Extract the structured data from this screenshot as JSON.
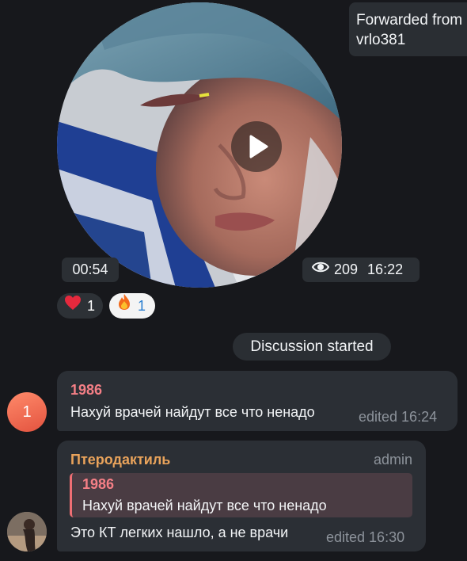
{
  "forwarded": {
    "line1": "Forwarded from",
    "line2": "vrlo381"
  },
  "video": {
    "duration": "00:54",
    "views": "209",
    "time": "16:22",
    "icons": {
      "play": "play-icon",
      "views": "eye-icon"
    }
  },
  "reactions": [
    {
      "emoji": "heart-icon",
      "count": "1",
      "color": "#e5293d"
    },
    {
      "emoji": "fire-icon",
      "count": "1",
      "color": "#f8a21d"
    }
  ],
  "discussion_label": "Discussion started",
  "messages": [
    {
      "author": "1986",
      "author_color": "#f47f86",
      "avatar_text": "1",
      "text": "Нахуй врачей найдут все что ненадо",
      "edited": "edited 16:24"
    },
    {
      "author": "Птеродактиль",
      "author_color": "#e9a35b",
      "role": "admin",
      "reply_to": {
        "author": "1986",
        "text": "Нахуй врачей найдут все что ненадо"
      },
      "text": "Это КТ легких нашло, а не врачи",
      "edited": "edited 16:30"
    }
  ],
  "colors": {
    "background": "#17181c",
    "bubble": "#2b2f35",
    "muted": "#8d939b"
  }
}
